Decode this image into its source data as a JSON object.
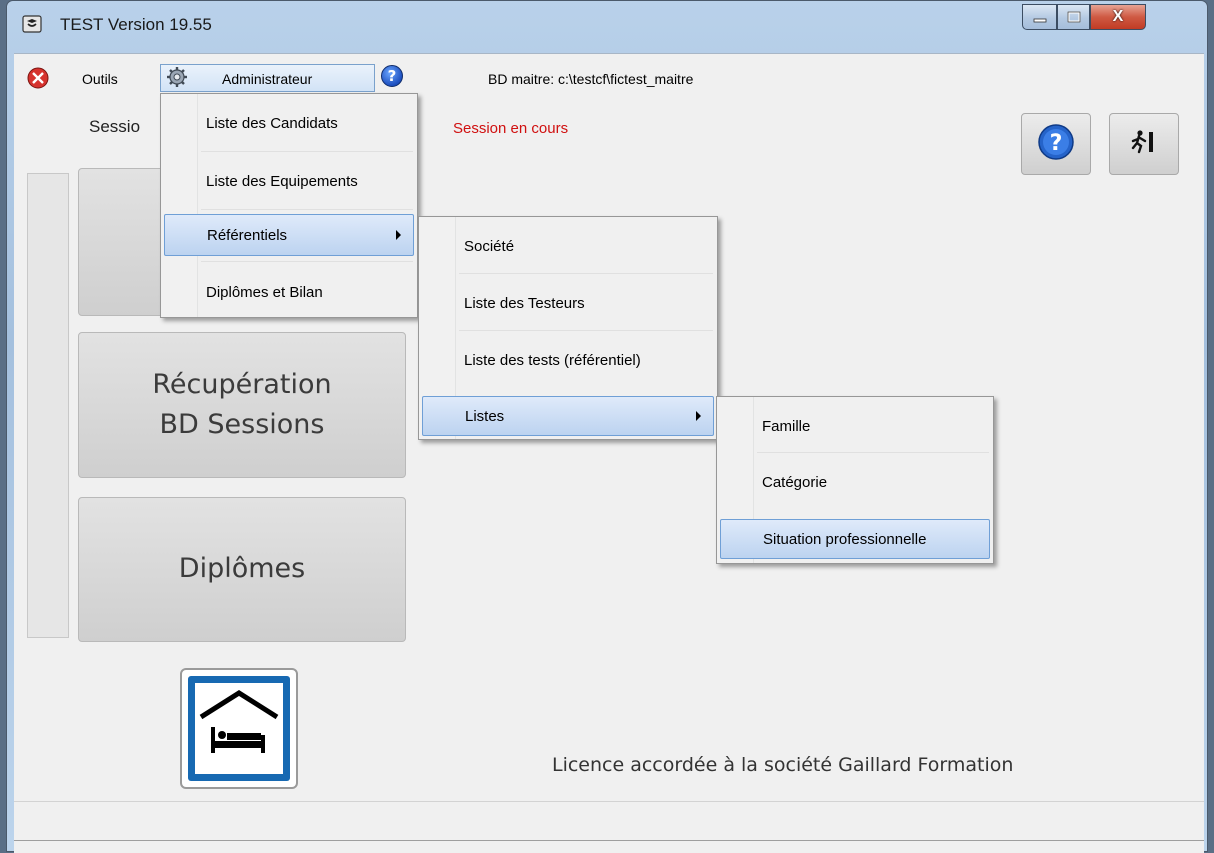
{
  "window": {
    "title": "TEST Version 19.55",
    "minimize_icon": "minimize-icon",
    "maximize_icon": "maximize-icon",
    "close_label": "X"
  },
  "menubar": {
    "outils": "Outils",
    "administrateur": "Administrateur",
    "help": "?",
    "db_path": "BD maitre: c:\\testcf\\fictest_maitre"
  },
  "header": {
    "session_label": "Sessio",
    "session_status": "Session en cours",
    "session_status_color": "#d01010"
  },
  "admin_menu": [
    {
      "label": "Liste des Candidats"
    },
    {
      "label": "Liste des Equipements"
    },
    {
      "label": "Référentiels"
    },
    {
      "label": "Diplômes et Bilan"
    }
  ],
  "referentiels_menu": [
    {
      "label": "Société"
    },
    {
      "label": "Liste des Testeurs"
    },
    {
      "label": "Liste des tests (référentiel)"
    },
    {
      "label": "Listes"
    }
  ],
  "listes_menu": [
    {
      "label": "Famille"
    },
    {
      "label": "Catégorie"
    },
    {
      "label": "Situation professionnelle"
    }
  ],
  "buttons": {
    "recuperation_line1": "Récupération",
    "recuperation_line2": "BD Sessions",
    "diplomes": "Diplômes"
  },
  "footer": {
    "licence": "Licence accordée à la société  Gaillard Formation"
  },
  "icons": {
    "app": "app-icon",
    "tools": "tools-icon",
    "gear": "gear-icon",
    "help": "help-icon",
    "exit": "exit-icon",
    "hotel": "hotel-icon"
  }
}
